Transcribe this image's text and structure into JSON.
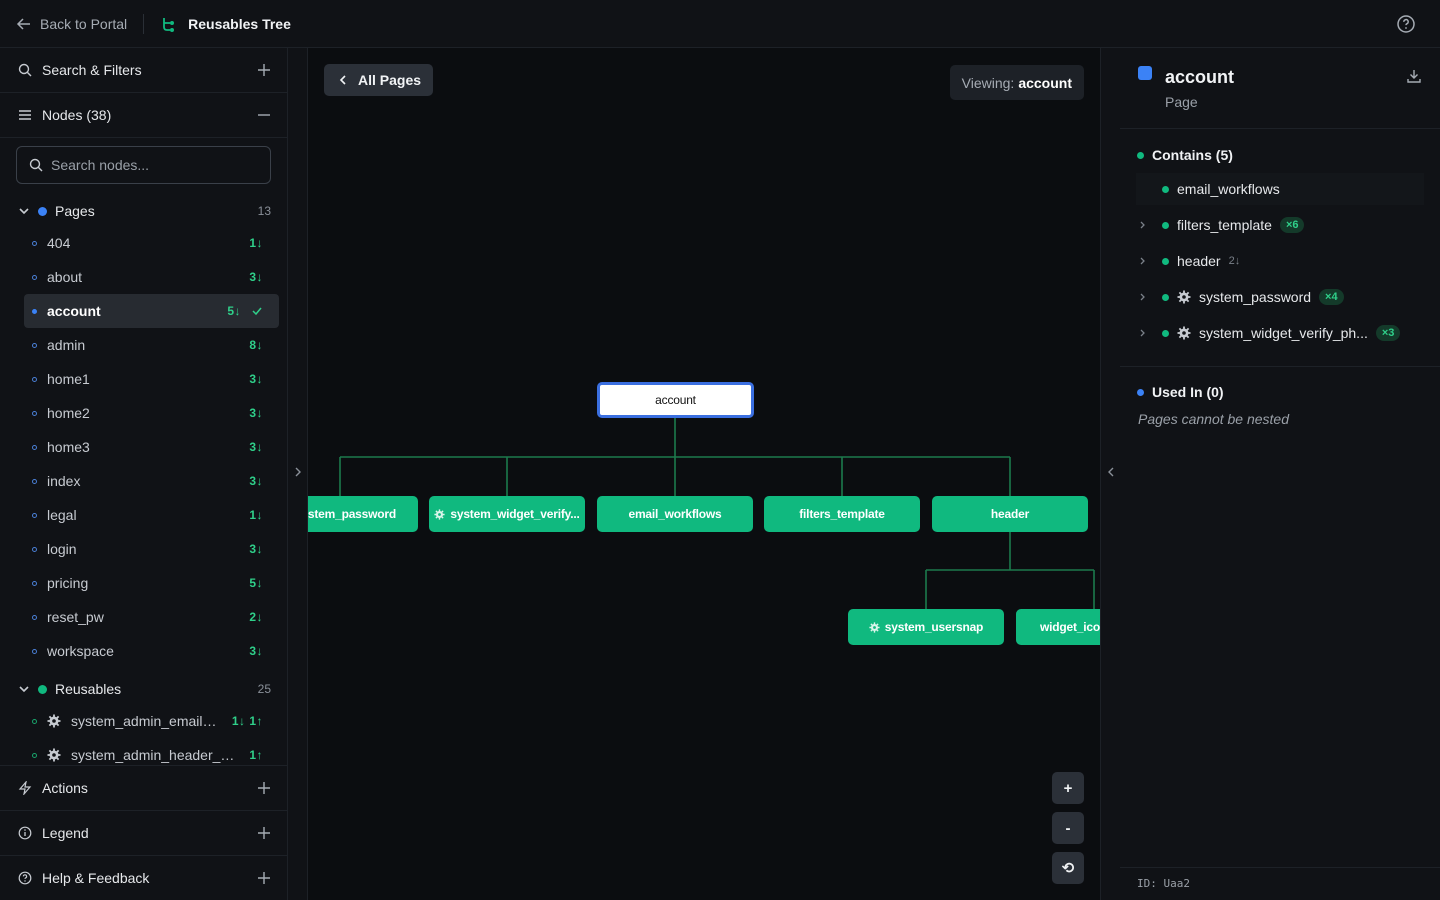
{
  "topbar": {
    "back_label": "Back to Portal",
    "brand_title": "Reusables Tree"
  },
  "sidebar": {
    "search_filters_label": "Search & Filters",
    "nodes_label": "Nodes (38)",
    "search_placeholder": "Search nodes...",
    "pages_group": {
      "label": "Pages",
      "count": "13",
      "color": "#3b82f6"
    },
    "pages": [
      {
        "label": "404",
        "badge": "1↓"
      },
      {
        "label": "about",
        "badge": "3↓"
      },
      {
        "label": "account",
        "badge": "5↓",
        "selected": true
      },
      {
        "label": "admin",
        "badge": "8↓"
      },
      {
        "label": "home1",
        "badge": "3↓"
      },
      {
        "label": "home2",
        "badge": "3↓"
      },
      {
        "label": "home3",
        "badge": "3↓"
      },
      {
        "label": "index",
        "badge": "3↓"
      },
      {
        "label": "legal",
        "badge": "1↓"
      },
      {
        "label": "login",
        "badge": "3↓"
      },
      {
        "label": "pricing",
        "badge": "5↓"
      },
      {
        "label": "reset_pw",
        "badge": "2↓"
      },
      {
        "label": "workspace",
        "badge": "3↓"
      }
    ],
    "reusables_group": {
      "label": "Reusables",
      "count": "25",
      "color": "#10b97f"
    },
    "reusables": [
      {
        "label": "system_admin_email_...",
        "badge": "1↓ 1↑"
      },
      {
        "label": "system_admin_header_m...",
        "badge": "1↑"
      }
    ],
    "actions_label": "Actions",
    "legend_label": "Legend",
    "help_label": "Help & Feedback"
  },
  "canvas": {
    "all_pages_label": "All Pages",
    "viewing_prefix": "Viewing:",
    "viewing_value": "account",
    "root_node": "account",
    "level1": [
      "ystem_password",
      "system_widget_verify...",
      "email_workflows",
      "filters_template",
      "header"
    ],
    "level2": [
      "system_usersnap",
      "widget_icon"
    ],
    "zoom_in": "+",
    "zoom_out": "-",
    "reset": "⟲"
  },
  "panel": {
    "title": "account",
    "subtitle": "Page",
    "contains_label": "Contains (5)",
    "contains": [
      {
        "label": "email_workflows"
      },
      {
        "label": "filters_template",
        "mult": "×6"
      },
      {
        "label": "header",
        "down": "2↓"
      },
      {
        "label": "system_password",
        "mult": "×4",
        "gear": true
      },
      {
        "label": "system_widget_verify_ph...",
        "mult": "×3",
        "gear": true
      }
    ],
    "used_in_label": "Used In (0)",
    "used_in_note": "Pages cannot be nested",
    "id_text": "ID: Uaa2"
  },
  "colors": {
    "page": "#3b82f6",
    "reusable": "#10b97f",
    "accent_text": "#2fd08a"
  }
}
